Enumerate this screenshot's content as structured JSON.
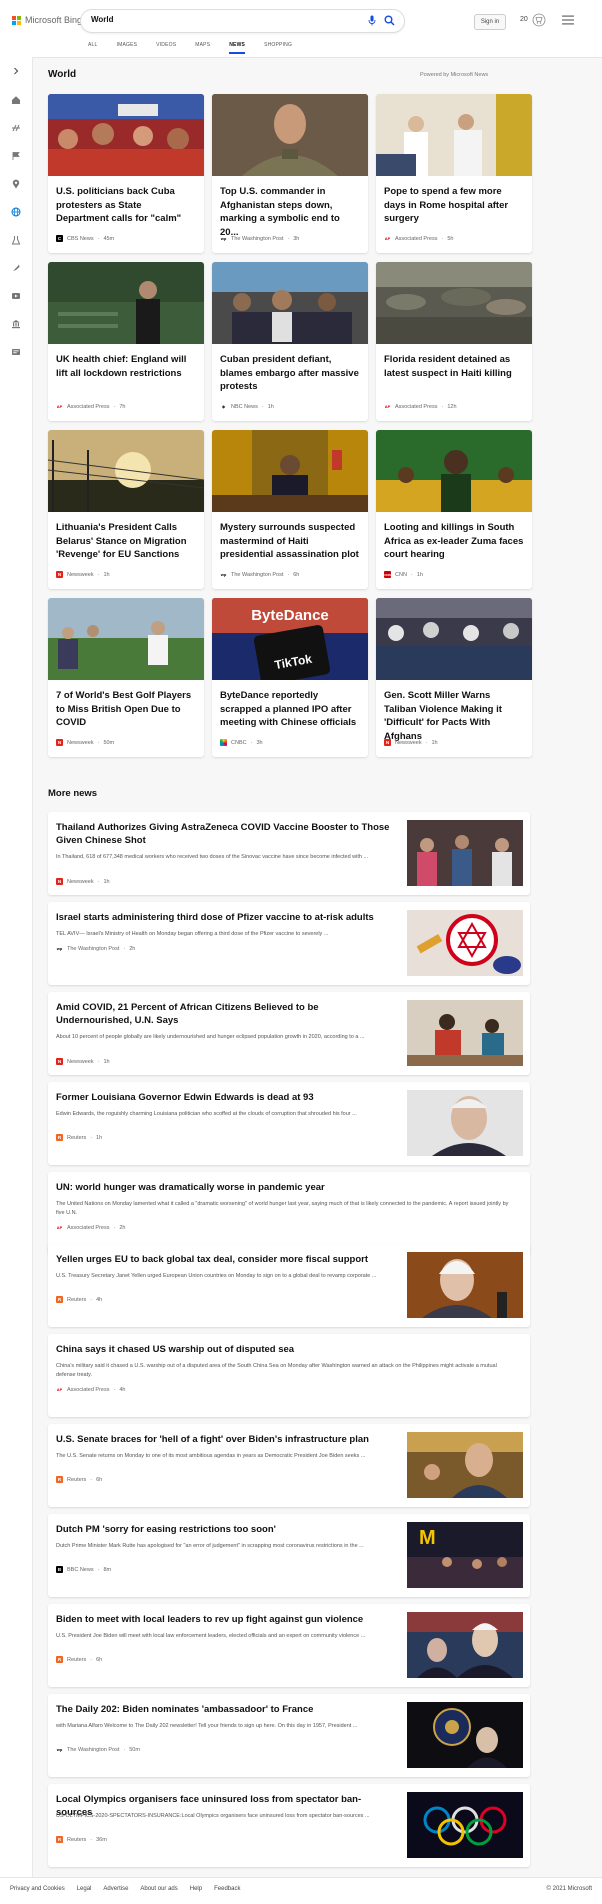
{
  "header": {
    "logo_text": "Microsoft Bing",
    "search_value": "World",
    "signin_label": "Sign in",
    "rewards_count": "20",
    "tabs": [
      {
        "label": "ALL"
      },
      {
        "label": "IMAGES"
      },
      {
        "label": "VIDEOS"
      },
      {
        "label": "MAPS"
      },
      {
        "label": "NEWS"
      },
      {
        "label": "SHOPPING"
      }
    ],
    "active_tab": "NEWS"
  },
  "sidebar": {
    "icons": [
      "expand-icon",
      "home-icon",
      "discover-icon",
      "following-icon",
      "local-icon",
      "world-icon",
      "science-icon",
      "sports-icon",
      "entertainment-icon",
      "money-icon",
      "news-icon"
    ]
  },
  "main": {
    "title": "World",
    "powered_by": "Powered by Microsoft News",
    "more_title": "More news",
    "top_stories": [
      {
        "title": "U.S. politicians back Cuba protesters as State Department calls for \"calm\"",
        "source": "CBS News",
        "age": "45m",
        "src_color": "#000000",
        "src_letter": "C"
      },
      {
        "title": "Top U.S. commander in Afghanistan steps down, marking a symbolic end to 20...",
        "source": "The Washington Post",
        "age": "3h",
        "src_color": "#000000",
        "src_letter": "wp"
      },
      {
        "title": "Pope to spend a few more days in Rome hospital after surgery",
        "source": "Associated Press",
        "age": "5h",
        "src_color": "#d0021b",
        "src_letter": "AP"
      },
      {
        "title": "UK health chief: England will lift all lockdown restrictions",
        "source": "Associated Press",
        "age": "7h",
        "src_color": "#d0021b",
        "src_letter": "AP"
      },
      {
        "title": "Cuban president defiant, blames embargo after massive protests",
        "source": "NBC News",
        "age": "1h",
        "src_color": "#333333",
        "src_letter": "N"
      },
      {
        "title": "Florida resident detained as latest suspect in Haiti killing",
        "source": "Associated Press",
        "age": "12h",
        "src_color": "#d0021b",
        "src_letter": "AP"
      },
      {
        "title": "Lithuania's President Calls Belarus' Stance on Migration 'Revenge' for EU Sanctions",
        "source": "Newsweek",
        "age": "1h",
        "src_color": "#e1251b",
        "src_letter": "N"
      },
      {
        "title": "Mystery surrounds suspected mastermind of Haiti presidential assassination plot",
        "source": "The Washington Post",
        "age": "6h",
        "src_color": "#000000",
        "src_letter": "wp"
      },
      {
        "title": "Looting and killings in South Africa as ex-leader Zuma faces court hearing",
        "source": "CNN",
        "age": "1h",
        "src_color": "#cc0000",
        "src_letter": "CNN"
      },
      {
        "title": "7 of World's Best Golf Players to Miss British Open Due to COVID",
        "source": "Newsweek",
        "age": "50m",
        "src_color": "#e1251b",
        "src_letter": "N"
      },
      {
        "title": "ByteDance reportedly scrapped a planned IPO after meeting with Chinese officials",
        "source": "CNBC",
        "age": "3h",
        "src_color": "#ffffff",
        "src_letter": "C"
      },
      {
        "title": "Gen. Scott Miller Warns Taliban Violence Making it 'Difficult' for Pacts With Afghans",
        "source": "Newsweek",
        "age": "1h",
        "src_color": "#e1251b",
        "src_letter": "N"
      }
    ],
    "more_news": [
      {
        "title": "Thailand Authorizes Giving AstraZeneca COVID Vaccine Booster to Those Given Chinese Shot",
        "snippet": "In Thailand, 618 of 677,348 medical workers who received two doses of the Sinovac vaccine have since become infected with ...",
        "source": "Newsweek",
        "age": "1h",
        "src_color": "#e1251b",
        "src_letter": "N",
        "has_image": true
      },
      {
        "title": "Israel starts administering third dose of Pfizer vaccine to at-risk adults",
        "snippet": "TEL AVIV— Israel's Ministry of Health on Monday began offering a third dose of the Pfizer vaccine to severely ...",
        "source": "The Washington Post",
        "age": "2h",
        "src_color": "#000000",
        "src_letter": "wp",
        "has_image": true
      },
      {
        "title": "Amid COVID, 21 Percent of African Citizens Believed to be Undernourished, U.N. Says",
        "snippet": "About 10 percent of people globally are likely undernourished and hunger eclipsed population growth in 2020, according to a ...",
        "source": "Newsweek",
        "age": "1h",
        "src_color": "#e1251b",
        "src_letter": "N",
        "has_image": true
      },
      {
        "title": "Former Louisiana Governor Edwin Edwards is dead at 93",
        "snippet": "Edwin Edwards, the roguishly charming Louisiana politician who scoffed at the clouds of corruption that shrouded his four ...",
        "source": "Reuters",
        "age": "1h",
        "src_color": "#f26522",
        "src_letter": "R",
        "has_image": true
      },
      {
        "title": "UN: world hunger was dramatically worse in pandemic year",
        "snippet": "The United Nations on Monday lamented what it called a \"dramatic worsening\" of world hunger last year, saying much of that is likely connected to the pandemic. A report issued jointly by five U.N.",
        "source": "Associated Press",
        "age": "2h",
        "src_color": "#d0021b",
        "src_letter": "AP",
        "has_image": false
      },
      {
        "title": "Yellen urges EU to back global tax deal, consider more fiscal support",
        "snippet": "U.S. Treasury Secretary Janet Yellen urged European Union countries on Monday to sign on to a global deal to revamp corporate ...",
        "source": "Reuters",
        "age": "4h",
        "src_color": "#f26522",
        "src_letter": "R",
        "has_image": true
      },
      {
        "title": "China says it chased US warship out of disputed sea",
        "snippet": "China's military said it chased a U.S. warship out of a disputed area of the South China Sea on Monday after Washington warned an attack on the Philippines might activate a mutual defense treaty.",
        "source": "Associated Press",
        "age": "4h",
        "src_color": "#d0021b",
        "src_letter": "AP",
        "has_image": false
      },
      {
        "title": "U.S. Senate braces for 'hell of a fight' over Biden's infrastructure plan",
        "snippet": "The U.S. Senate returns on Monday to one of its most ambitious agendas in years as Democratic President Joe Biden seeks ...",
        "source": "Reuters",
        "age": "6h",
        "src_color": "#f26522",
        "src_letter": "R",
        "has_image": true
      },
      {
        "title": "Dutch PM 'sorry for easing restrictions too soon'",
        "snippet": "Dutch Prime Minister Mark Rutte has apologised for \"an error of judgement\" in scrapping most coronavirus restrictions in the ...",
        "source": "BBC News",
        "age": "8m",
        "src_color": "#000000",
        "src_letter": "B",
        "has_image": true
      },
      {
        "title": "Biden to meet with local leaders to rev up fight against gun violence",
        "snippet": "U.S. President Joe Biden will meet with local law enforcement leaders, elected officials and an expert on community violence ...",
        "source": "Reuters",
        "age": "6h",
        "src_color": "#f26522",
        "src_letter": "R",
        "has_image": true
      },
      {
        "title": "The Daily 202: Biden nominates 'ambassadoor' to France",
        "snippet": "with Mariana Alfaro Welcome to The Daily 202 newsletter! Tell your friends to sign up here. On this day in 1957, President ...",
        "source": "The Washington Post",
        "age": "50m",
        "src_color": "#000000",
        "src_letter": "wp",
        "has_image": true
      },
      {
        "title": "Local Olympics organisers face uninsured loss from spectator ban-sources",
        "snippet": "US-OLYMPICS-2020-SPECTATORS-INSURANCE:Local Olympics organisers face uninsured loss from spectator ban-sources ...",
        "source": "Reuters",
        "age": "36m",
        "src_color": "#f26522",
        "src_letter": "R",
        "has_image": true
      }
    ]
  },
  "footer": {
    "links": [
      "Privacy and Cookies",
      "Legal",
      "Advertise",
      "About our ads",
      "Help",
      "Feedback"
    ],
    "copyright": "© 2021 Microsoft"
  },
  "colors": {
    "accent": "#174ae4",
    "bing_blue": "#0078d4"
  }
}
